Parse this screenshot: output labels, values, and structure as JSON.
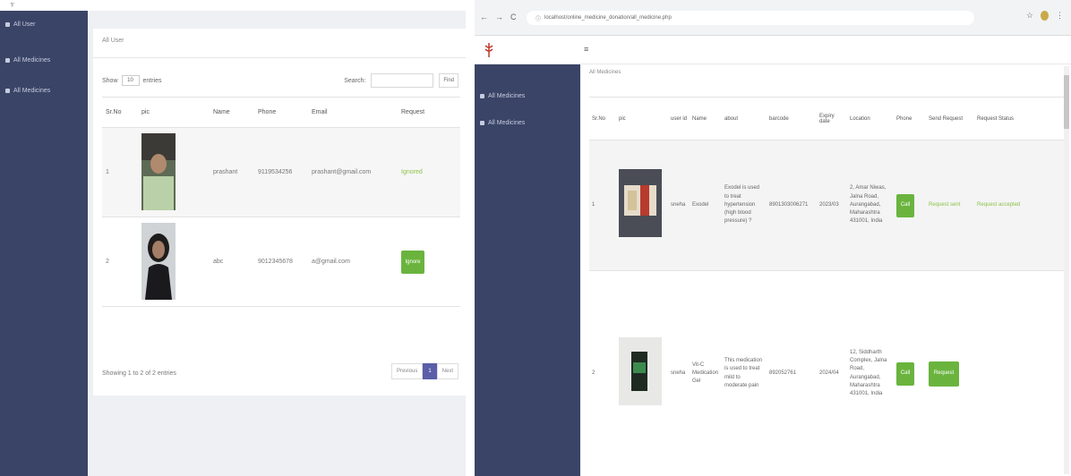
{
  "left": {
    "breadcrumb": "All User",
    "sidebar": [
      {
        "label": "All User"
      },
      {
        "label": "All Medicines"
      },
      {
        "label": "All Medicines"
      }
    ],
    "show_label": "Show",
    "entries_value": "10",
    "entries_label": "entries",
    "search_label": "Search:",
    "find_label": "Find",
    "columns": [
      "Sr.No",
      "pic",
      "Name",
      "Phone",
      "Email",
      "Request"
    ],
    "rows": [
      {
        "no": "1",
        "name": "prashant",
        "phone": "9119534256",
        "email": "prashant@gmail.com",
        "request": "Ignored"
      },
      {
        "no": "2",
        "name": "abc",
        "phone": "9012345678",
        "email": "a@gmail.com",
        "request": "Ignore"
      }
    ],
    "footer": "Showing 1 to 2 of 2 entries",
    "pager": {
      "prev": "Previous",
      "page": "1",
      "next": "Next"
    }
  },
  "right": {
    "browser": {
      "url": "localhost/online_medicine_donation/all_medicine.php",
      "nav": [
        "←",
        "→",
        "C"
      ],
      "menu": "⋮"
    },
    "hamburger": "≡",
    "breadcrumb": "All Medicines",
    "sidebar": [
      {
        "label": "All Medicines"
      },
      {
        "label": "All Medicines"
      }
    ],
    "columns": [
      "Sr.No",
      "pic",
      "user id",
      "Name",
      "about",
      "barcode",
      "Expiry date",
      "Location",
      "Phone",
      "Send Request",
      "Request Status"
    ],
    "rows": [
      {
        "no": "1",
        "user": "sneha",
        "name": "Exodel",
        "about": "Exodel is used to treat hypertension (high blood pressure) ?",
        "barcode": "8901303006271",
        "expiry": "2023/03",
        "location": "2, Amar Niwas, Jalna Road, Aurangabad, Maharashtra 431001, India",
        "phone": "Call",
        "send_request": "Request sent",
        "status": "Request accepted"
      },
      {
        "no": "2",
        "user": "sneha",
        "name": "Vit-C Medication Gel",
        "about": "This medication is used to treat mild to moderate pain",
        "barcode": "892052761",
        "expiry": "2024/04",
        "location": "12, Siddharth Complex, Jalna Road, Aurangabad, Maharashtra 431001, India",
        "phone": "Call",
        "send_request": "Request",
        "status": ""
      }
    ]
  },
  "colors": {
    "sidebar": "#3a4466",
    "accent_green": "#6ab43e",
    "pager_active": "#5a5fa8"
  }
}
